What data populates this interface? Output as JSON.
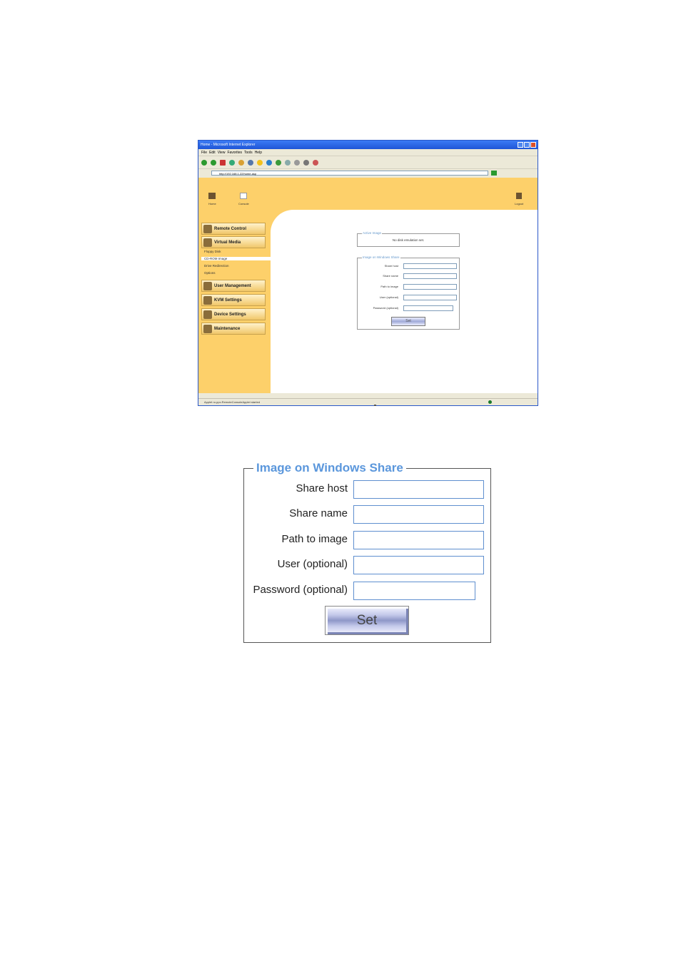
{
  "browser": {
    "title": "Home - Microsoft Internet Explorer",
    "menu": [
      "File",
      "Edit",
      "View",
      "Favorites",
      "Tools",
      "Help"
    ],
    "address": "http://192.168.1.22/home.asp",
    "status": "Applet ru.ppc.RemoteConsoleApplet started",
    "top_nav": {
      "home": "Home",
      "console": "Console",
      "logout": "Logout"
    },
    "sidebar": {
      "remote_control": "Remote Control",
      "virtual_media": "Virtual Media",
      "sub_floppy": "Floppy Disk",
      "sub_cdrom": "CD-ROM Image",
      "sub_drive": "Drive Redirection",
      "sub_options": "Options",
      "user_management": "User Management",
      "kvm_settings": "KVM Settings",
      "device_settings": "Device Settings",
      "maintenance": "Maintenance"
    },
    "active_image": {
      "legend": "Active Image",
      "text": "No disk emulation set."
    },
    "mini_form": {
      "legend": "Image on Windows Share",
      "share_host": "Share host",
      "share_name": "Share name",
      "path": "Path to image",
      "user": "User (optional)",
      "password": "Password (optional)",
      "set": "Set"
    }
  },
  "form": {
    "legend": "Image on Windows Share",
    "fields": {
      "share_host": {
        "label": "Share host",
        "value": ""
      },
      "share_name": {
        "label": "Share name",
        "value": ""
      },
      "path": {
        "label": "Path to image",
        "value": ""
      },
      "user": {
        "label": "User (optional)",
        "value": ""
      },
      "password": {
        "label": "Password (optional)",
        "value": ""
      }
    },
    "set_label": "Set"
  },
  "colors": {
    "legend": "#5b97dc",
    "sidebar": "#fdd06a",
    "field_border": "#5f8fcf"
  }
}
